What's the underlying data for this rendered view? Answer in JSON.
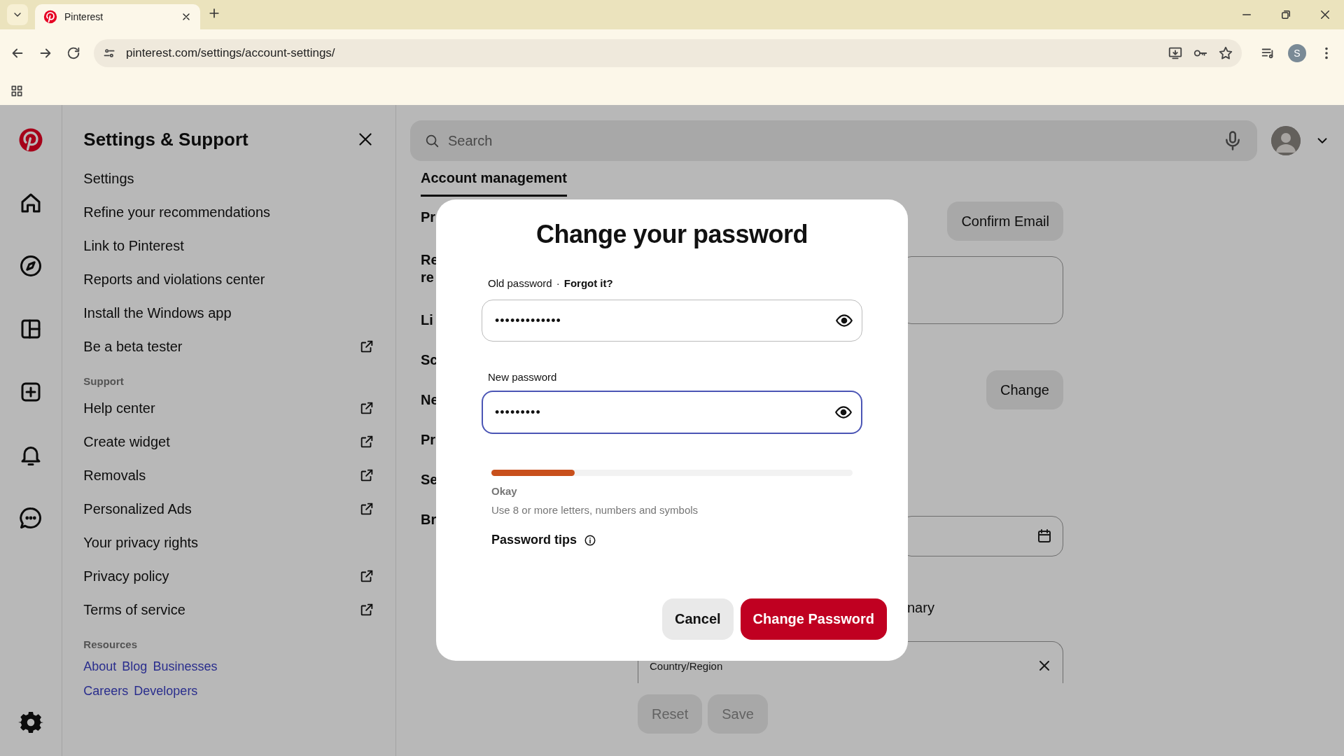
{
  "browser": {
    "tab_title": "Pinterest",
    "url": "pinterest.com/settings/account-settings/",
    "profile_initial": "S"
  },
  "settings_panel": {
    "title": "Settings & Support",
    "sections": [
      {
        "items": [
          {
            "label": "Settings",
            "external": false
          },
          {
            "label": "Refine your recommendations",
            "external": false
          },
          {
            "label": "Link to Pinterest",
            "external": false
          },
          {
            "label": "Reports and violations center",
            "external": false
          },
          {
            "label": "Install the Windows app",
            "external": false
          },
          {
            "label": "Be a beta tester",
            "external": true
          }
        ]
      },
      {
        "heading": "Support",
        "items": [
          {
            "label": "Help center",
            "external": true
          },
          {
            "label": "Create widget",
            "external": true
          },
          {
            "label": "Removals",
            "external": true
          },
          {
            "label": "Personalized Ads",
            "external": true
          },
          {
            "label": "Your privacy rights",
            "external": false
          },
          {
            "label": "Privacy policy",
            "external": true
          },
          {
            "label": "Terms of service",
            "external": true
          }
        ]
      }
    ],
    "resources": {
      "heading": "Resources",
      "link_rows": [
        [
          "About",
          "Blog",
          "Businesses"
        ],
        [
          "Careers",
          "Developers"
        ]
      ]
    }
  },
  "search": {
    "placeholder": "Search"
  },
  "account": {
    "tabs": [
      {
        "label": "Account management",
        "selected": true
      }
    ],
    "row_labels": [
      [
        "Pr"
      ],
      [
        "Re",
        "re"
      ],
      [
        "Li"
      ],
      [
        "Sc"
      ],
      [
        "Ne"
      ],
      [
        "Pr"
      ],
      [
        "Se"
      ],
      [
        "Br"
      ]
    ],
    "confirm_email_button": "Confirm Email",
    "change_button": "Change",
    "partial_text": "nary",
    "country_field": {
      "label": "Country/Region"
    },
    "actions": [
      {
        "label": "Reset",
        "disabled": true
      },
      {
        "label": "Save",
        "disabled": true
      }
    ]
  },
  "dialog": {
    "title": "Change your password",
    "old_password": {
      "label": "Old password",
      "separator": "·",
      "forgot_link": "Forgot it?",
      "value": "•••••••••••••",
      "focused": false
    },
    "new_password": {
      "label": "New password",
      "value": "•••••••••",
      "focused": true
    },
    "strength": {
      "level": 0.23,
      "label": "Okay",
      "hint": "Use 8 or more letters, numbers and symbols"
    },
    "tips": "Password tips",
    "buttons": [
      {
        "label": "Cancel",
        "kind": "secondary"
      },
      {
        "label": "Change Password",
        "kind": "primary"
      }
    ]
  }
}
